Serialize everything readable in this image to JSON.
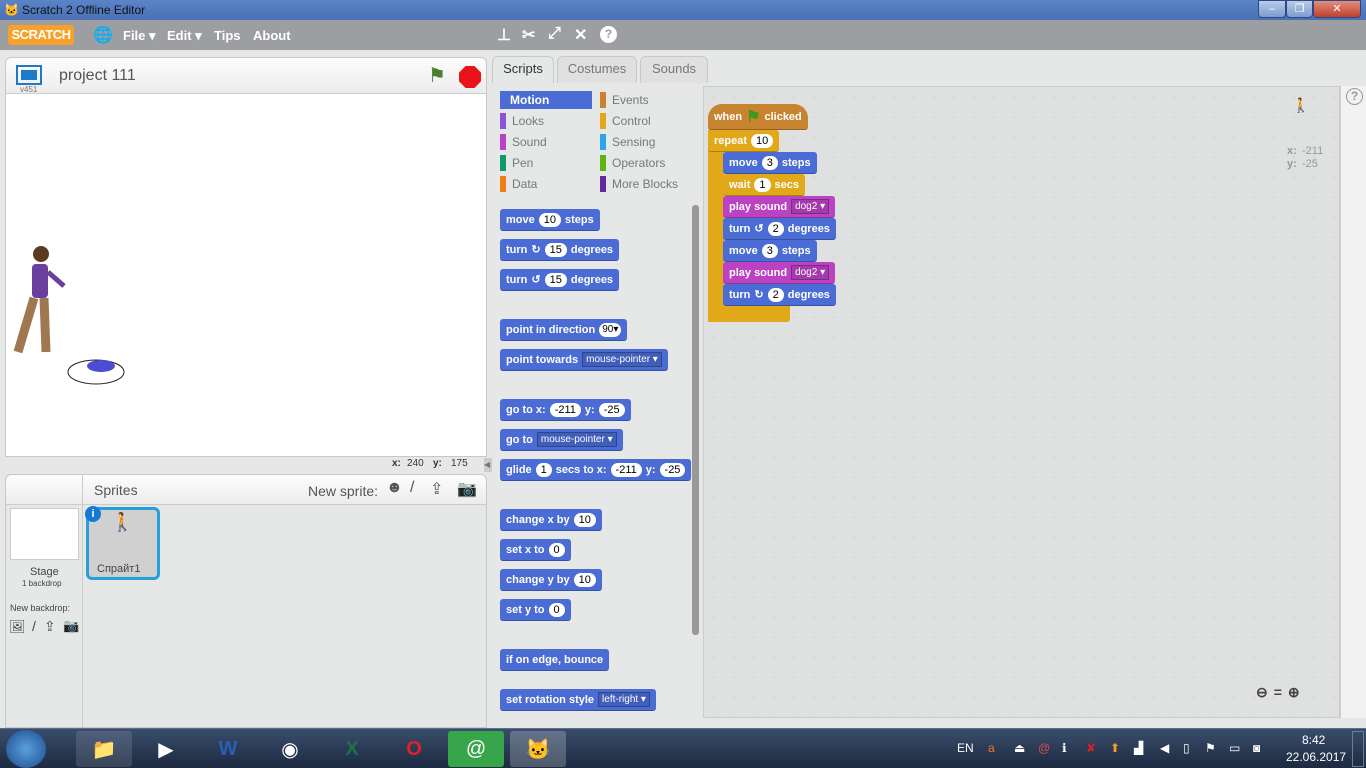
{
  "window": {
    "title": "Scratch 2 Offline Editor",
    "minimize": "–",
    "maximize": "❐",
    "close": "✕"
  },
  "menubar": {
    "logo": "SCRATCH",
    "items": [
      "File ▾",
      "Edit ▾",
      "Tips",
      "About"
    ]
  },
  "stage": {
    "project_name": "project 111",
    "version": "v451",
    "mouse_x_label": "x:",
    "mouse_x": "240",
    "mouse_y_label": "y:",
    "mouse_y": "175"
  },
  "sprites": {
    "title": "Sprites",
    "new_sprite_label": "New sprite:",
    "stage_label": "Stage",
    "backdrop_count": "1 backdrop",
    "new_backdrop_label": "New backdrop:",
    "items": [
      {
        "name": "Спрайт1"
      }
    ]
  },
  "tabs": [
    "Scripts",
    "Costumes",
    "Sounds"
  ],
  "categories": [
    {
      "label": "Motion",
      "color": "#4a6cd4",
      "active": true
    },
    {
      "label": "Events",
      "color": "#c88330"
    },
    {
      "label": "Looks",
      "color": "#8a55d7"
    },
    {
      "label": "Control",
      "color": "#e1a91a"
    },
    {
      "label": "Sound",
      "color": "#bb42c3"
    },
    {
      "label": "Sensing",
      "color": "#2ca5e2"
    },
    {
      "label": "Pen",
      "color": "#0e9a6c"
    },
    {
      "label": "Operators",
      "color": "#5cb712"
    },
    {
      "label": "Data",
      "color": "#ee7d16"
    },
    {
      "label": "More Blocks",
      "color": "#632d99"
    }
  ],
  "colors": {
    "motion": "#4a6cd4",
    "control": "#e1a91a",
    "events": "#c88330",
    "sound": "#bb42c3"
  },
  "palette_blocks": [
    {
      "parts": [
        [
          "t",
          "move"
        ],
        [
          "n",
          "10"
        ],
        [
          "t",
          "steps"
        ]
      ]
    },
    {
      "parts": [
        [
          "t",
          "turn"
        ],
        [
          "t",
          "↻"
        ],
        [
          "n",
          "15"
        ],
        [
          "t",
          "degrees"
        ]
      ]
    },
    {
      "parts": [
        [
          "t",
          "turn"
        ],
        [
          "t",
          "↺"
        ],
        [
          "n",
          "15"
        ],
        [
          "t",
          "degrees"
        ]
      ]
    },
    {
      "parts": [
        [
          "t",
          "point in direction"
        ],
        [
          "w",
          "90▾"
        ]
      ]
    },
    {
      "parts": [
        [
          "t",
          "point towards"
        ],
        [
          "d",
          "mouse-pointer ▾"
        ]
      ]
    },
    {
      "parts": [
        [
          "t",
          "go to x:"
        ],
        [
          "n",
          "-211"
        ],
        [
          "t",
          "y:"
        ],
        [
          "n",
          "-25"
        ]
      ]
    },
    {
      "parts": [
        [
          "t",
          "go to"
        ],
        [
          "d",
          "mouse-pointer ▾"
        ]
      ]
    },
    {
      "parts": [
        [
          "t",
          "glide"
        ],
        [
          "n",
          "1"
        ],
        [
          "t",
          "secs to x:"
        ],
        [
          "n",
          "-211"
        ],
        [
          "t",
          "y:"
        ],
        [
          "n",
          "-25"
        ]
      ]
    },
    {
      "parts": [
        [
          "t",
          "change x by"
        ],
        [
          "n",
          "10"
        ]
      ]
    },
    {
      "parts": [
        [
          "t",
          "set x to"
        ],
        [
          "n",
          "0"
        ]
      ]
    },
    {
      "parts": [
        [
          "t",
          "change y by"
        ],
        [
          "n",
          "10"
        ]
      ]
    },
    {
      "parts": [
        [
          "t",
          "set y to"
        ],
        [
          "n",
          "0"
        ]
      ]
    },
    {
      "parts": [
        [
          "t",
          "if on edge, bounce"
        ]
      ]
    },
    {
      "parts": [
        [
          "t",
          "set rotation style"
        ],
        [
          "d",
          "left-right ▾"
        ]
      ]
    }
  ],
  "script": {
    "hat": {
      "parts": [
        [
          "t",
          "when"
        ],
        [
          "t",
          "⚑"
        ],
        [
          "t",
          "clicked"
        ]
      ]
    },
    "repeat": {
      "parts": [
        [
          "t",
          "repeat"
        ],
        [
          "n",
          "10"
        ]
      ]
    },
    "body": [
      {
        "c": "motion",
        "parts": [
          [
            "t",
            "move"
          ],
          [
            "n",
            "3"
          ],
          [
            "t",
            "steps"
          ]
        ]
      },
      {
        "c": "control",
        "parts": [
          [
            "t",
            "wait"
          ],
          [
            "n",
            "1"
          ],
          [
            "t",
            "secs"
          ]
        ]
      },
      {
        "c": "sound",
        "parts": [
          [
            "t",
            "play sound"
          ],
          [
            "d",
            "dog2 ▾"
          ]
        ]
      },
      {
        "c": "motion",
        "parts": [
          [
            "t",
            "turn"
          ],
          [
            "t",
            "↺"
          ],
          [
            "n",
            "2"
          ],
          [
            "t",
            "degrees"
          ]
        ]
      },
      {
        "c": "motion",
        "parts": [
          [
            "t",
            "move"
          ],
          [
            "n",
            "3"
          ],
          [
            "t",
            "steps"
          ]
        ]
      },
      {
        "c": "sound",
        "parts": [
          [
            "t",
            "play sound"
          ],
          [
            "d",
            "dog2 ▾"
          ]
        ]
      },
      {
        "c": "motion",
        "parts": [
          [
            "t",
            "turn"
          ],
          [
            "t",
            "↻"
          ],
          [
            "n",
            "2"
          ],
          [
            "t",
            "degrees"
          ]
        ]
      }
    ]
  },
  "sprite_info": {
    "x_label": "x:",
    "x": "-211",
    "y_label": "y:",
    "y": "-25"
  },
  "taskbar": {
    "lang": "EN",
    "time": "8:42",
    "date": "22.06.2017"
  }
}
